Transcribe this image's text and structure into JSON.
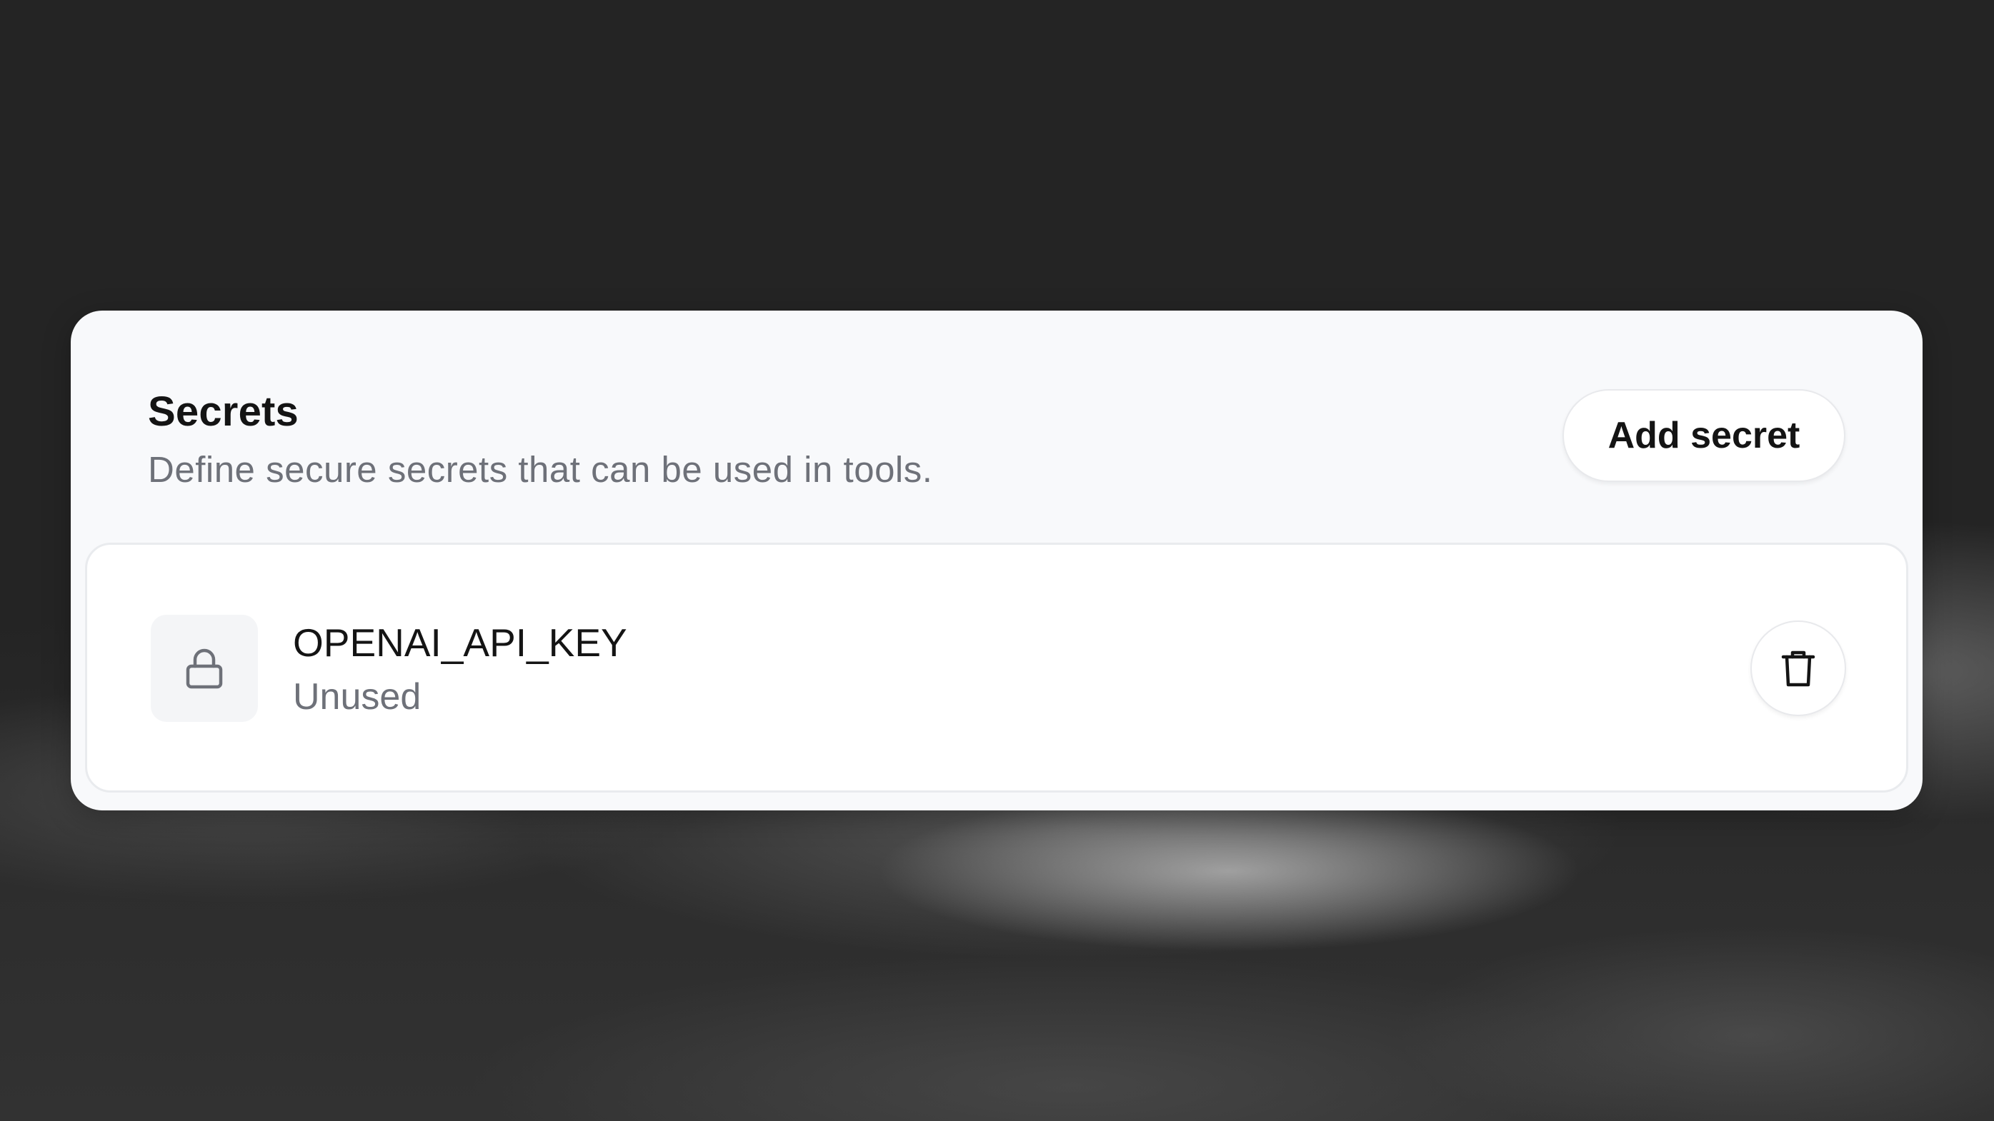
{
  "panel": {
    "title": "Secrets",
    "subtitle": "Define secure secrets that can be used in tools.",
    "add_button_label": "Add secret"
  },
  "secrets": [
    {
      "name": "OPENAI_API_KEY",
      "status": "Unused",
      "icon": "lock-icon",
      "action_icon": "trash-icon"
    }
  ],
  "colors": {
    "backdrop": "#252525",
    "card": "#f8f9fb",
    "list": "#ffffff",
    "primary_text": "#141414",
    "secondary_text": "#6e7179"
  }
}
